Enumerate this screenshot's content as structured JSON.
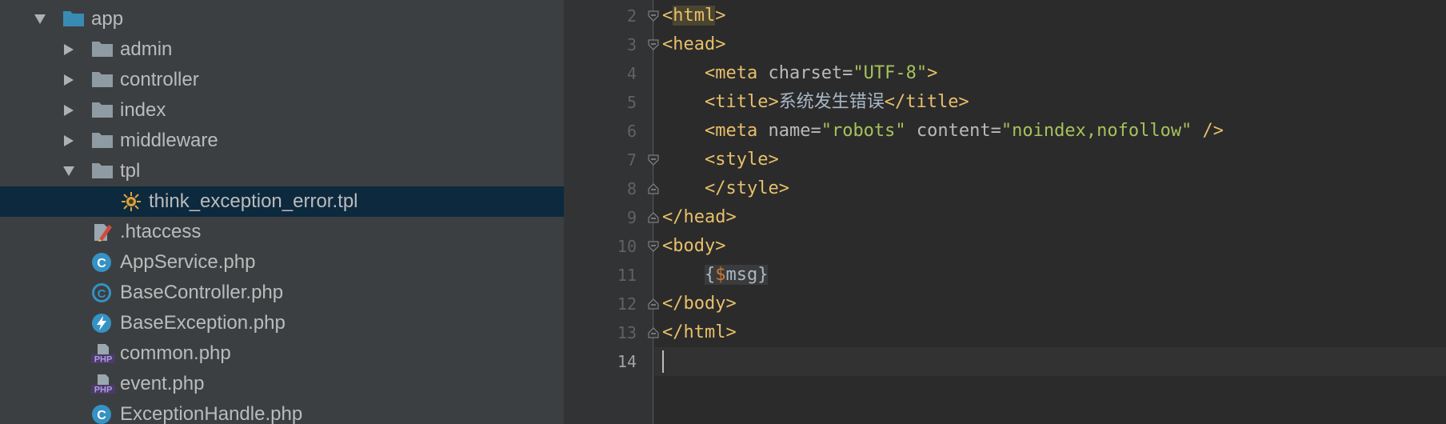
{
  "project_tree": {
    "items": [
      {
        "label": "app",
        "kind": "folder-blue",
        "expanded": true
      },
      {
        "label": "admin",
        "kind": "folder",
        "expanded": false
      },
      {
        "label": "controller",
        "kind": "folder",
        "expanded": false
      },
      {
        "label": "index",
        "kind": "folder",
        "expanded": false
      },
      {
        "label": "middleware",
        "kind": "folder",
        "expanded": false
      },
      {
        "label": "tpl",
        "kind": "folder",
        "expanded": true
      },
      {
        "label": "think_exception_error.tpl",
        "kind": "tpl-file",
        "selected": true
      },
      {
        "label": ".htaccess",
        "kind": "htaccess-file"
      },
      {
        "label": "AppService.php",
        "kind": "class-file"
      },
      {
        "label": "BaseController.php",
        "kind": "abstract-class-file"
      },
      {
        "label": "BaseException.php",
        "kind": "exception-file"
      },
      {
        "label": "common.php",
        "kind": "php-file"
      },
      {
        "label": "event.php",
        "kind": "php-file"
      },
      {
        "label": "ExceptionHandle.php",
        "kind": "class-file"
      }
    ],
    "php_badge": "PHP",
    "class_badge": "C"
  },
  "editor": {
    "line_numbers": [
      "2",
      "3",
      "4",
      "5",
      "6",
      "7",
      "8",
      "9",
      "10",
      "11",
      "12",
      "13",
      "14"
    ],
    "lines": {
      "l2": {
        "open": "<",
        "tag": "html",
        "close": ">"
      },
      "l3": {
        "text": "<head>"
      },
      "l4": {
        "lt": "<",
        "tag": "meta",
        "attr": " charset=",
        "val": "\"UTF-8\"",
        "gt": ">"
      },
      "l5": {
        "open": "<title>",
        "text": "系统发生错误",
        "close": "</title>"
      },
      "l6": {
        "lt": "<",
        "tag": "meta",
        "attr1": " name=",
        "val1": "\"robots\"",
        "attr2": " content=",
        "val2": "\"noindex,nofollow\"",
        "end": " />"
      },
      "l7": {
        "text": "<style>"
      },
      "l8": {
        "text": "</style>"
      },
      "l9": {
        "text": "</head>"
      },
      "l10": {
        "text": "<body>"
      },
      "l11": {
        "lb": "{",
        "dollar": "$",
        "name": "msg",
        "rb": "}"
      },
      "l12": {
        "text": "</body>"
      },
      "l13": {
        "text": "</html>"
      }
    }
  }
}
